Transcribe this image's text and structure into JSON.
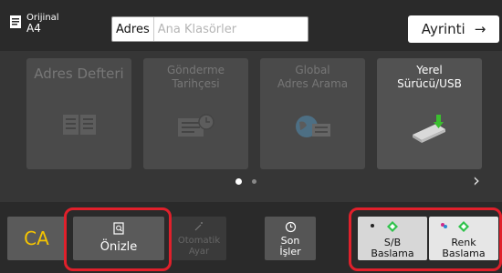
{
  "header": {
    "original_label": "Orijinal",
    "original_value": "A4",
    "address_label": "Adres",
    "address_placeholder": "Ana Klasörler",
    "detail_label": "Ayrinti",
    "detail_arrow": "→"
  },
  "tiles": [
    {
      "label": "Adres Defteri",
      "icon": "address-book-icon",
      "active": false
    },
    {
      "label": "Gönderme\nTarihçesi",
      "icon": "history-icon",
      "active": false
    },
    {
      "label": "Global\nAdres Arama",
      "icon": "global-address-icon",
      "active": false
    },
    {
      "label": "Yerel\nSürücü/USB",
      "icon": "usb-drive-icon",
      "active": true
    }
  ],
  "pager": {
    "current": 1,
    "total": 2,
    "next_icon": "chevron-right-icon"
  },
  "footer": {
    "ca_label": "CA",
    "preview_label": "Önizle",
    "auto_label": "Otomatik\nAyar",
    "last_label": "Son\nİşler",
    "bw_label": "S/B\nBaslama",
    "color_label": "Renk\nBaslama"
  },
  "colors": {
    "highlight": "#e0202b",
    "ca_text": "#f5c400",
    "start_diamond": "#2ec24a",
    "usb_arrow": "#3bbf2f"
  }
}
